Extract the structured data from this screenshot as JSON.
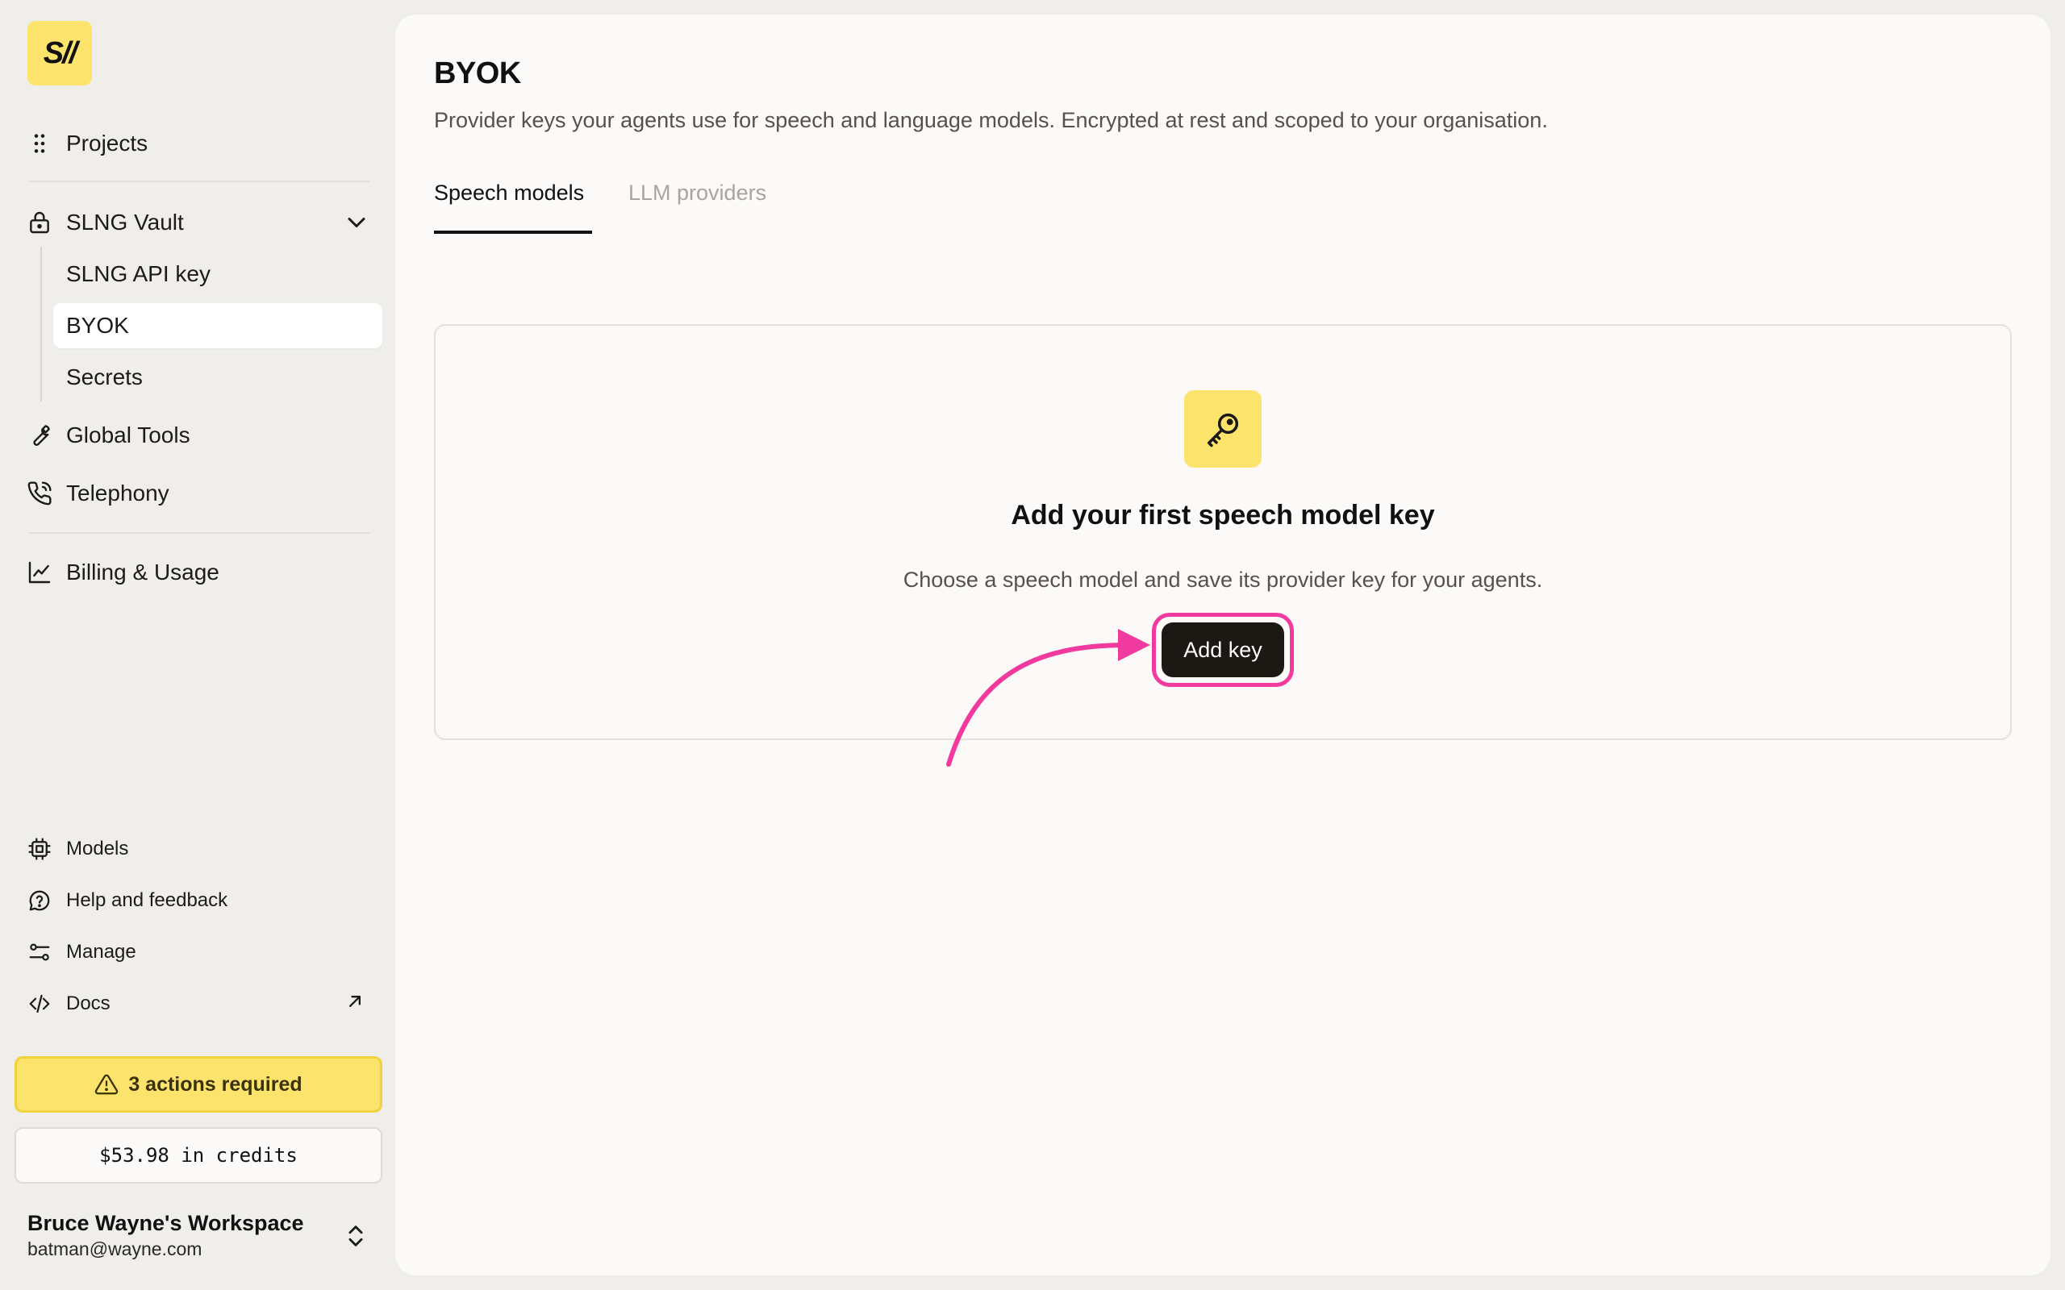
{
  "sidebar": {
    "logo": "S//",
    "projects": "Projects",
    "vault": "SLNG Vault",
    "vault_items": [
      "SLNG API key",
      "BYOK",
      "Secrets"
    ],
    "global_tools": "Global Tools",
    "telephony": "Telephony",
    "billing": "Billing & Usage",
    "models": "Models",
    "help": "Help and feedback",
    "manage": "Manage",
    "docs": "Docs",
    "actions_required": "3 actions required",
    "credits": "$53.98 in credits",
    "workspace_name": "Bruce Wayne's Workspace",
    "workspace_email": "batman@wayne.com"
  },
  "main": {
    "title": "BYOK",
    "description": "Provider keys your agents use for speech and language models. Encrypted at rest and scoped to your organisation.",
    "tabs": [
      {
        "label": "Speech models",
        "active": true
      },
      {
        "label": "LLM providers",
        "active": false
      }
    ],
    "empty_state": {
      "title": "Add your first speech model key",
      "description": "Choose a speech model and save its provider key for your agents.",
      "button": "Add key"
    }
  },
  "colors": {
    "accent_yellow": "#fbe36c",
    "highlight_pink": "#f2399d",
    "button_dark": "#1c1814"
  }
}
